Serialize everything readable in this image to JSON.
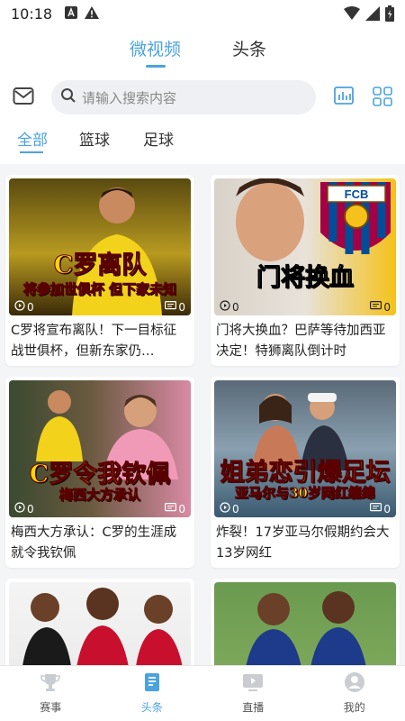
{
  "status": {
    "time": "10:18"
  },
  "top_tabs": [
    {
      "label": "微视频",
      "active": true
    },
    {
      "label": "头条",
      "active": false
    }
  ],
  "search": {
    "placeholder": "请输入搜索内容"
  },
  "categories": [
    {
      "label": "全部",
      "active": true
    },
    {
      "label": "篮球",
      "active": false
    },
    {
      "label": "足球",
      "active": false
    }
  ],
  "cards": [
    {
      "title": "C罗将宣布离队！下一目标征战世俱杯，但新东家仍…",
      "caption_big": "C罗离队",
      "caption_small": "将参加世俱杯 但下家未知",
      "plays": "0",
      "comments": "0"
    },
    {
      "title": "门将大换血？巴萨等待加西亚决定！特狮离队倒计时",
      "caption_big": "门将换血",
      "caption_small": "",
      "badge_text": "FCB",
      "plays": "0",
      "comments": "0"
    },
    {
      "title": "梅西大方承认：C罗的生涯成就令我钦佩",
      "caption_big": "C罗令我钦佩",
      "caption_small": "梅西大方承认",
      "plays": "0",
      "comments": "0"
    },
    {
      "title": "炸裂！17岁亚马尔假期约会大13岁网红",
      "caption_big": "姐弟恋引爆足坛",
      "caption_small": "亚马尔与30岁网红缠绵",
      "plays": "0",
      "comments": "0"
    },
    {
      "title": "",
      "caption_big": "",
      "caption_small": "",
      "plays": "",
      "comments": ""
    },
    {
      "title": "",
      "caption_big": "",
      "caption_small": "",
      "plays": "",
      "comments": ""
    }
  ],
  "bottom_nav": [
    {
      "label": "赛事",
      "icon": "trophy-icon",
      "active": false
    },
    {
      "label": "头条",
      "icon": "news-icon",
      "active": true
    },
    {
      "label": "直播",
      "icon": "live-icon",
      "active": false
    },
    {
      "label": "我的",
      "icon": "user-icon",
      "active": false
    }
  ],
  "colors": {
    "accent": "#4aa3df",
    "caption": "#ffd500"
  }
}
